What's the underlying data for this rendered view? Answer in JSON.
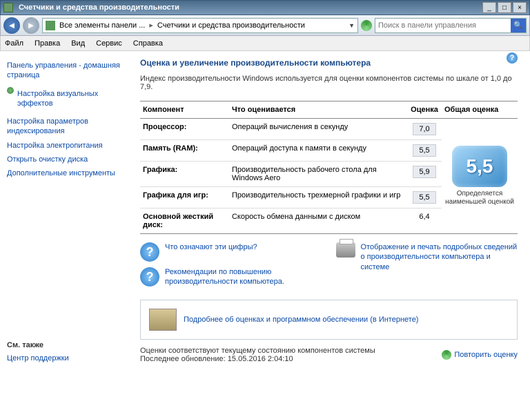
{
  "window": {
    "title": "Счетчики и средства производительности"
  },
  "nav": {
    "crumb1": "Все элементы панели ...",
    "crumb2": "Счетчики и средства производительности",
    "search_placeholder": "Поиск в панели управления"
  },
  "menu": {
    "file": "Файл",
    "edit": "Правка",
    "view": "Вид",
    "service": "Сервис",
    "help": "Справка"
  },
  "sidebar": {
    "home": "Панель управления - домашняя страница",
    "visual": "Настройка визуальных эффектов",
    "indexing": "Настройка параметров индексирования",
    "power": "Настройка электропитания",
    "cleanup": "Открыть очистку диска",
    "tools": "Дополнительные инструменты",
    "seealso_h": "См. также",
    "support": "Центр поддержки"
  },
  "main": {
    "heading": "Оценка и увеличение производительности компьютера",
    "desc": "Индекс производительности Windows используется для оценки компонентов системы по шкале от 1,0 до 7,9.",
    "col_component": "Компонент",
    "col_what": "Что оценивается",
    "col_score": "Оценка",
    "col_base": "Общая оценка",
    "rows": [
      {
        "c": "Процессор:",
        "w": "Операций вычисления в секунду",
        "s": "7,0"
      },
      {
        "c": "Память (RAM):",
        "w": "Операций доступа к памяти в секунду",
        "s": "5,5"
      },
      {
        "c": "Графика:",
        "w": "Производительность рабочего стола для Windows Aero",
        "s": "5,9"
      },
      {
        "c": "Графика для игр:",
        "w": "Производительность трехмерной графики и игр",
        "s": "5,5"
      },
      {
        "c": "Основной жесткий диск:",
        "w": "Скорость обмена данными с диском",
        "s": "6,4"
      }
    ],
    "base_score": "5,5",
    "base_txt": "Определяется наименьшей оценкой",
    "link_what": "Что означают эти цифры?",
    "link_tips": "Рекомендации по повышению производительности компьютера.",
    "link_print": "Отображение и печать подробных сведений о производительности компьютера и системе",
    "link_more": "Подробнее об оценках и программном обеспечении (в Интернете)",
    "status1": "Оценки соответствуют текущему состоянию компонентов системы",
    "status2": "Последнее обновление: 15.05.2016 2:04:10",
    "refresh": "Повторить оценку"
  }
}
